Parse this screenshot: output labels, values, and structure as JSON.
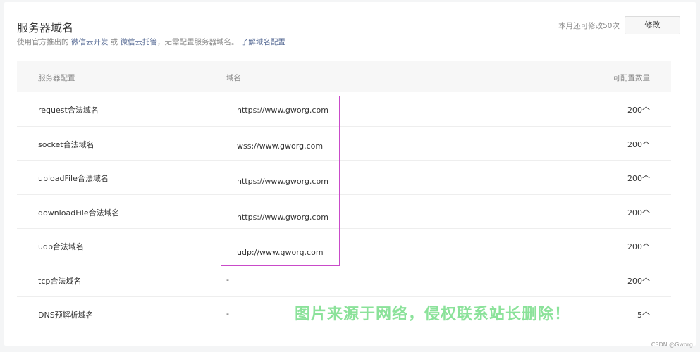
{
  "header": {
    "title": "服务器域名",
    "desc_prefix": "使用官方推出的",
    "link_cloud_dev": "微信云开发",
    "desc_or": "或",
    "link_cloud_host": "微信云托管",
    "desc_suffix": "，无需配置服务器域名。",
    "link_learn": "了解域名配置",
    "quota_text": "本月还可修改50次",
    "modify_label": "修改"
  },
  "table": {
    "headers": [
      "服务器配置",
      "域名",
      "可配置数量"
    ],
    "rows": [
      {
        "name": "request合法域名",
        "domain": "",
        "count": "200个"
      },
      {
        "name": "socket合法域名",
        "domain": "",
        "count": "200个"
      },
      {
        "name": "uploadFile合法域名",
        "domain": "",
        "count": "200个"
      },
      {
        "name": "downloadFile合法域名",
        "domain": "",
        "count": "200个"
      },
      {
        "name": "udp合法域名",
        "domain": "",
        "count": "200个"
      },
      {
        "name": "tcp合法域名",
        "domain": "-",
        "count": "200个"
      },
      {
        "name": "DNS预解析域名",
        "domain": "-",
        "count": "5个"
      }
    ]
  },
  "highlighted_domains": [
    "https://www.gworg.com",
    "wss://www.gworg.com",
    "https://www.gworg.com",
    "https://www.gworg.com",
    "udp://www.gworg.com"
  ],
  "watermark": "图片来源于网络，侵权联系站长删除！",
  "credit": "CSDN @Gworg",
  "colors": {
    "link": "#576b95",
    "highlight_border": "#c94ac9",
    "watermark": "#8be29a"
  }
}
